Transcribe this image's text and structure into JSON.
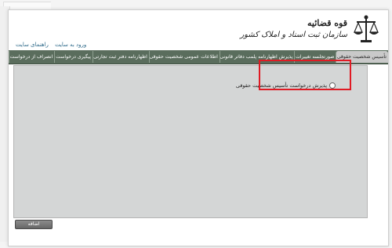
{
  "header": {
    "org_name": "قوه قضائیه",
    "org_sub": "سازمان ثبت اسناد و املاک کشور",
    "logo_icon": "scales-of-justice-emblem-icon"
  },
  "top_links": {
    "login": "ورود به سایت",
    "guide": "راهنمای سایت"
  },
  "tabs": [
    "تأسیس شخصیت حقوقی",
    "صورتجلسه تغییرات",
    "پذیرش اظهارنامه پلمب دفاتر قانونی",
    "اطلاعات عمومی شخصیت حقوقی",
    "اظهارنامه دفتر ثبت تجارتی",
    "پیگیری درخواست",
    "انصراف از درخواست"
  ],
  "form": {
    "option_label": "پذیرش درخواست تأسیس شخصیت حقوقی"
  },
  "actions": {
    "add_label": "اضافه"
  },
  "colors": {
    "tab_bar": "#5a6d5d",
    "content_bg": "#d4d6d6",
    "highlight": "#e01b24"
  }
}
